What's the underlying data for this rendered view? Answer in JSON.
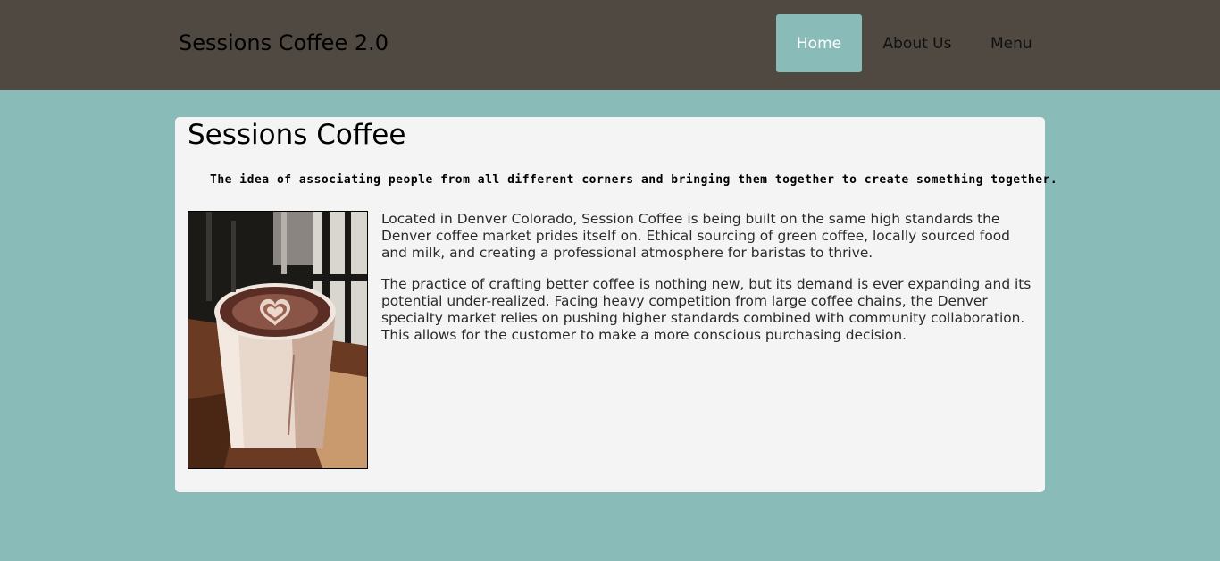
{
  "header": {
    "brand": "Sessions Coffee 2.0",
    "nav": [
      {
        "label": "Home",
        "active": true
      },
      {
        "label": "About Us",
        "active": false
      },
      {
        "label": "Menu",
        "active": false
      }
    ]
  },
  "main": {
    "title": "Sessions Coffee",
    "tagline": "The idea of associating people from all different corners and bringing them together to create something together.",
    "paragraphs": [
      "Located in Denver Colorado, Session Coffee is being built on the same high standards the Denver coffee market prides itself on. Ethical sourcing of green coffee, locally sourced food and milk, and creating a professional atmosphere for baristas to thrive.",
      "The practice of crafting better coffee is nothing new, but its demand is ever expanding and its potential under-realized. Facing heavy competition from large coffee chains, the Denver specialty market relies on pushing higher standards combined with community collaboration. This allows for the customer to make a more conscious purchasing decision."
    ]
  },
  "colors": {
    "header_bg": "#4f4942",
    "page_bg": "#89bcb9",
    "card_bg": "#f4f4f4",
    "active_nav_bg": "#89bcb9"
  }
}
